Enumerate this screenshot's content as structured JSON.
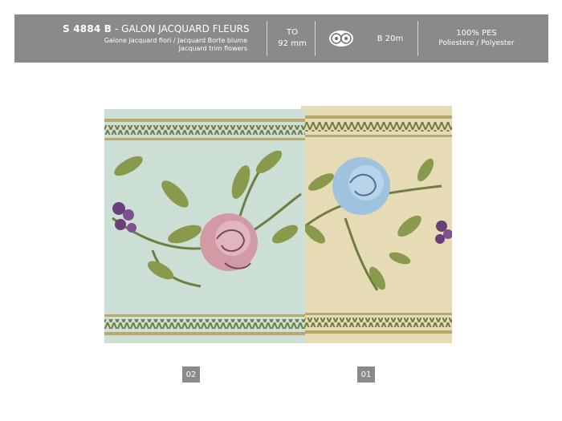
{
  "header": {
    "code": "S 4884 B",
    "separator": "-",
    "title": "GALON JACQUARD FLEURS",
    "subtitle_lines": [
      "Galone Jacquard fiori / Jacquard Borte blume",
      "Jacquard trim flowers"
    ],
    "width_label": "TO",
    "width_value": "92 mm",
    "icon": "reel-icon",
    "length": "B 20m",
    "composition": "100% PES",
    "composition_detail": "Poliestere / Polyester"
  },
  "swatches": [
    {
      "label": "02",
      "base_color": "#c9ddd3",
      "rose_color": "#d19aa5"
    },
    {
      "label": "01",
      "base_color": "#e4d9b0",
      "rose_color": "#9ec3df"
    }
  ],
  "colors": {
    "header_bg": "#8a8a8a",
    "border_green": "#6f7d42",
    "leaf_green": "#8a9a4c",
    "grape_purple": "#6a3f7a"
  }
}
